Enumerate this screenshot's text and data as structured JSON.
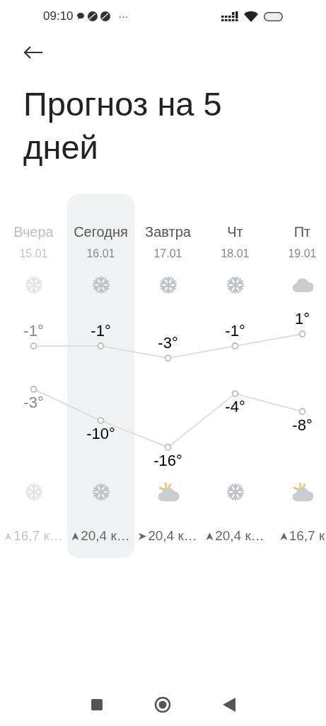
{
  "status_bar": {
    "time": "09:10",
    "more": "···"
  },
  "title": "Прогноз на 5 дней",
  "days": [
    {
      "label": "Вчера",
      "date": "15.01",
      "past": true,
      "selected": false,
      "day_icon": {
        "kind": "snow"
      },
      "high": "-1°",
      "low": "-3°",
      "night_icon": {
        "kind": "snow"
      },
      "wind_arrow": {
        "kind": "up"
      },
      "wind": "16,7 к…"
    },
    {
      "label": "Сегодня",
      "date": "16.01",
      "past": false,
      "selected": true,
      "day_icon": {
        "kind": "snow"
      },
      "high": "-1°",
      "low": "-10°",
      "night_icon": {
        "kind": "snow"
      },
      "wind_arrow": {
        "kind": "up"
      },
      "wind": "20,4 к…"
    },
    {
      "label": "Завтра",
      "date": "17.01",
      "past": false,
      "selected": false,
      "day_icon": {
        "kind": "snow"
      },
      "high": "-3°",
      "low": "-16°",
      "night_icon": {
        "kind": "partly_cloudy"
      },
      "wind_arrow": {
        "kind": "right"
      },
      "wind": "20,4 к…"
    },
    {
      "label": "Чт",
      "date": "18.01",
      "past": false,
      "selected": false,
      "day_icon": {
        "kind": "snow"
      },
      "high": "-1°",
      "low": "-4°",
      "night_icon": {
        "kind": "snow"
      },
      "wind_arrow": {
        "kind": "up"
      },
      "wind": "20,4 к…"
    },
    {
      "label": "Пт",
      "date": "19.01",
      "past": false,
      "selected": false,
      "day_icon": {
        "kind": "cloud"
      },
      "high": "1°",
      "low": "-8°",
      "night_icon": {
        "kind": "partly_cloudy"
      },
      "wind_arrow": {
        "kind": "up"
      },
      "wind": "16,7 к"
    }
  ]
}
